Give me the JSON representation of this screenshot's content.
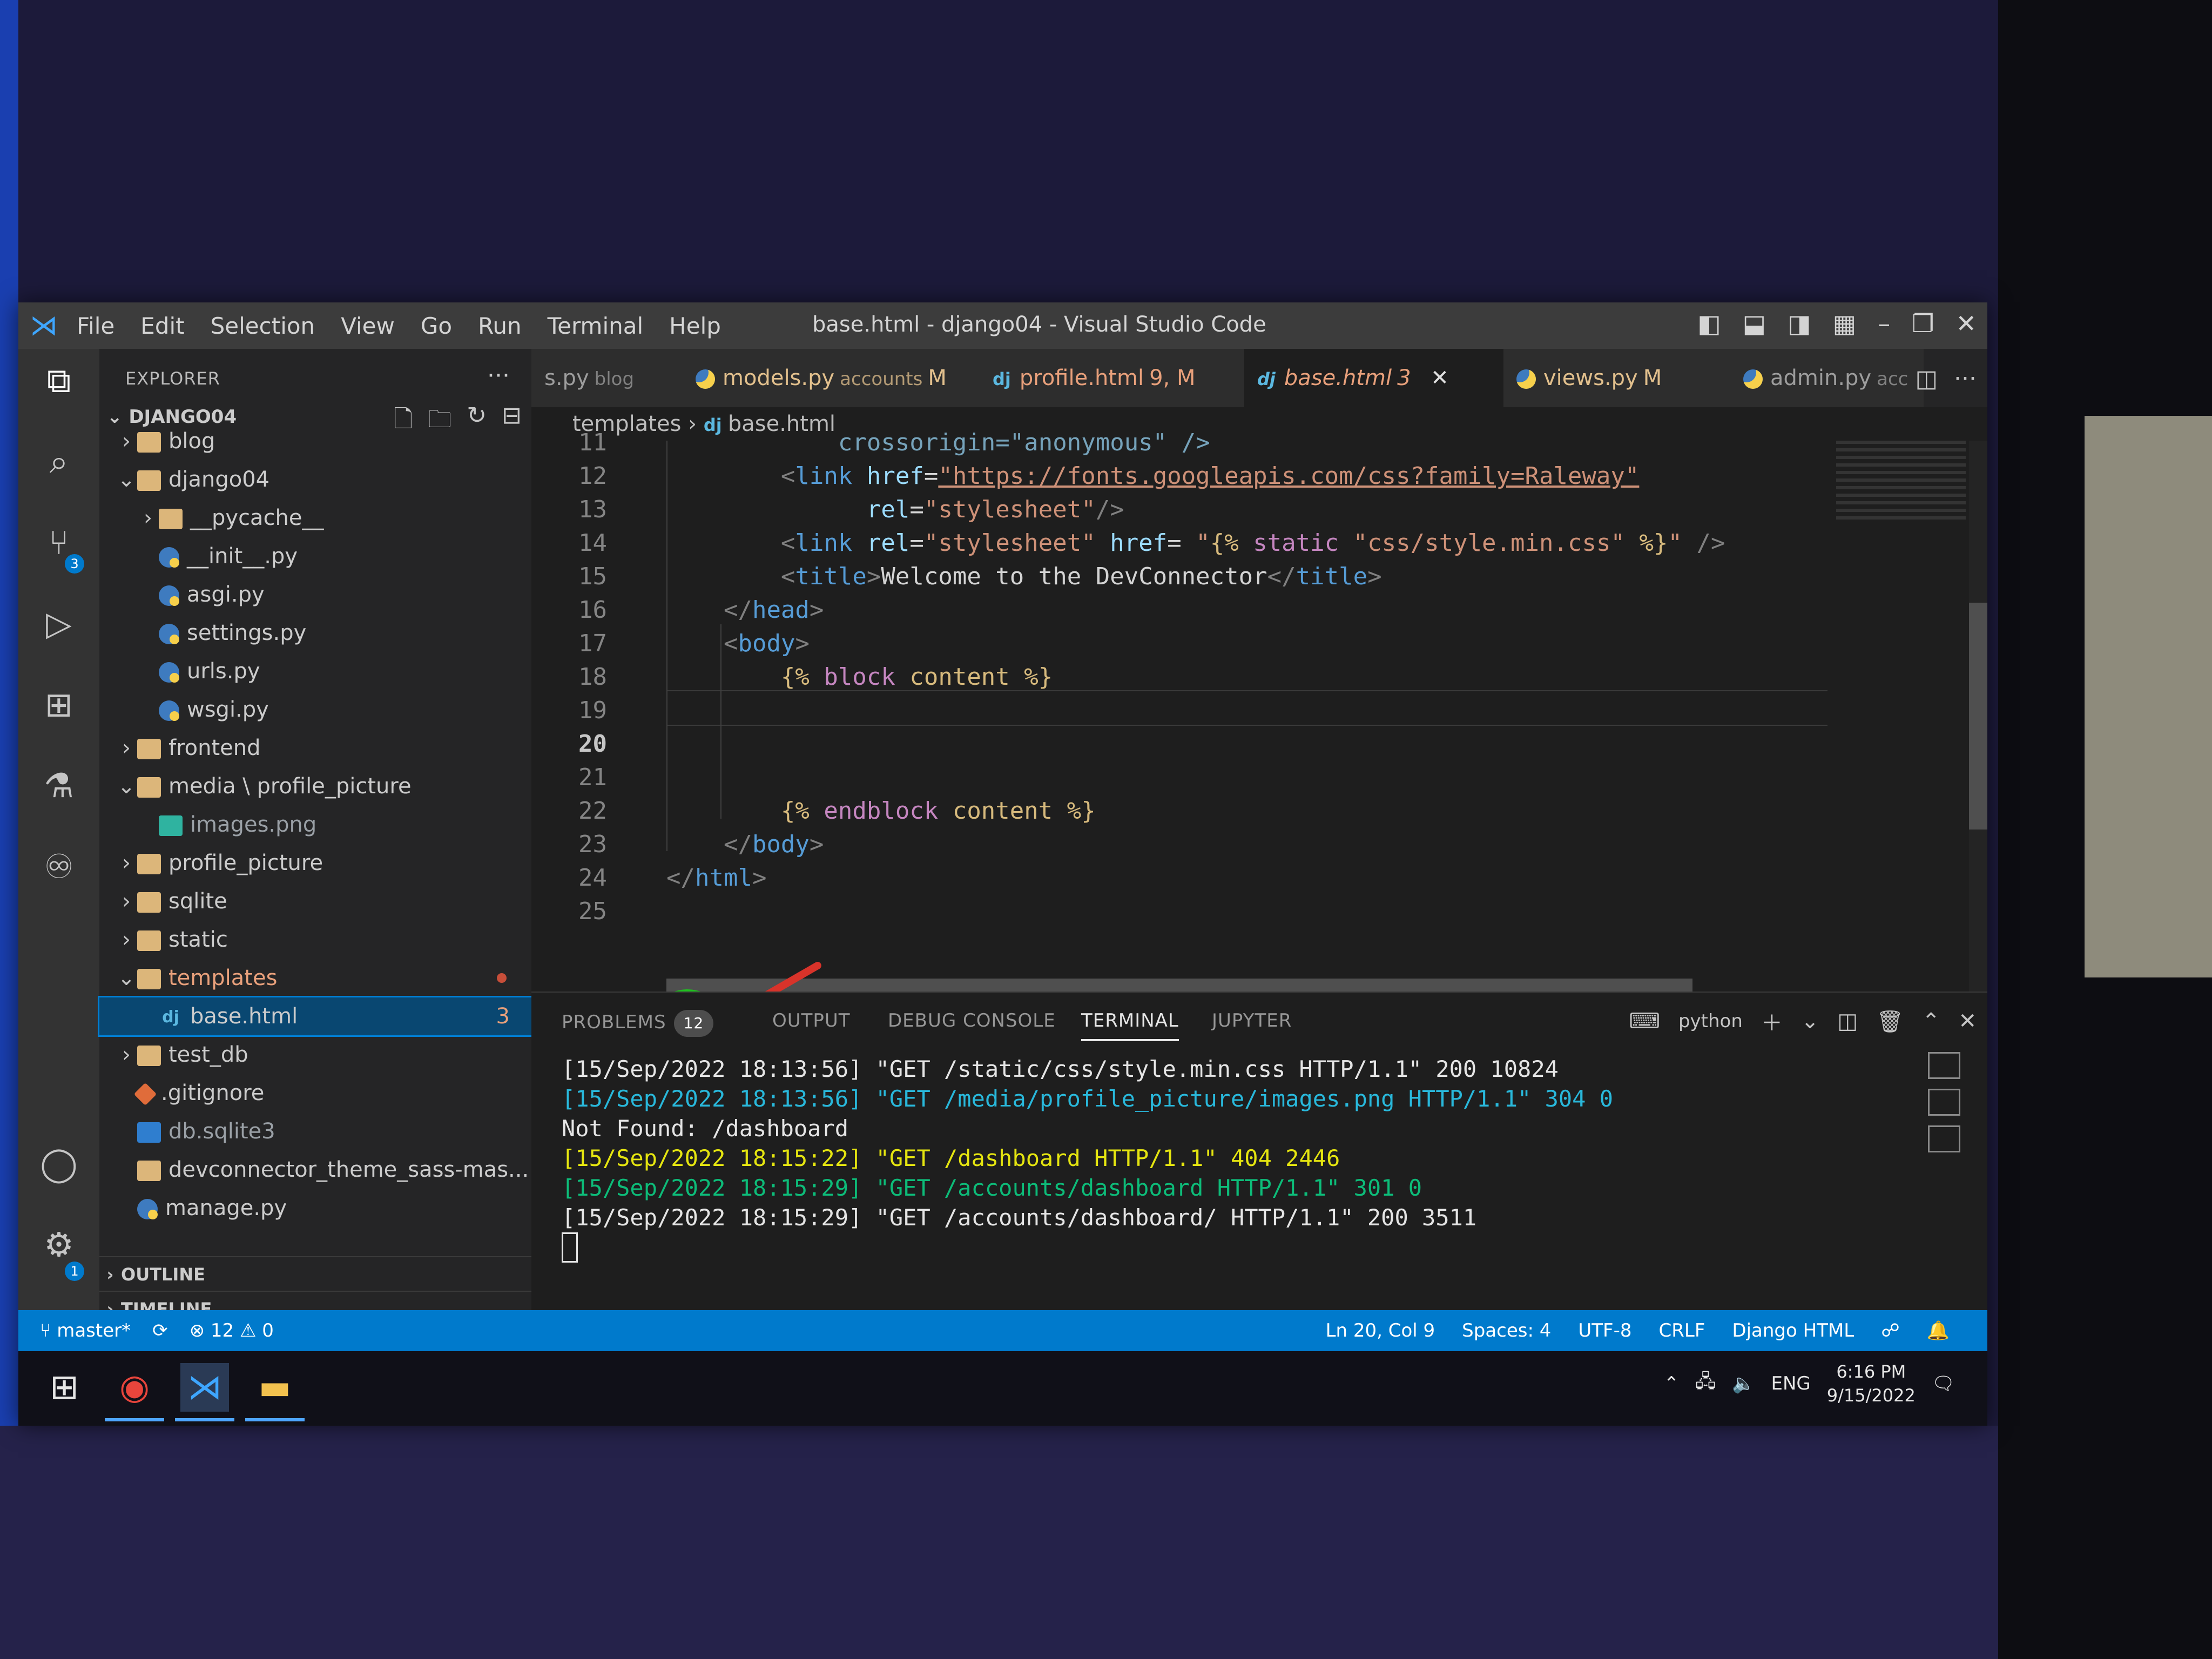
{
  "menu": {
    "items": [
      "File",
      "Edit",
      "Selection",
      "View",
      "Go",
      "Run",
      "Terminal",
      "Help"
    ],
    "window_title": "base.html - django04 - Visual Studio Code"
  },
  "activity": {
    "scm_badge": "3",
    "accounts_badge": "1"
  },
  "sidebar": {
    "header": "EXPLORER",
    "root": "DJANGO04",
    "items": [
      {
        "label": "blog",
        "type": "folder",
        "twisty": "›"
      },
      {
        "label": "django04",
        "type": "folder",
        "twisty": "⌄"
      },
      {
        "label": "__pycache__",
        "type": "folder",
        "twisty": "›"
      },
      {
        "label": "__init__.py",
        "type": "py"
      },
      {
        "label": "asgi.py",
        "type": "py"
      },
      {
        "label": "settings.py",
        "type": "py"
      },
      {
        "label": "urls.py",
        "type": "py"
      },
      {
        "label": "wsgi.py",
        "type": "py"
      },
      {
        "label": "frontend",
        "type": "folder",
        "twisty": "›"
      },
      {
        "label": "media \\ profile_picture",
        "type": "folder",
        "twisty": "⌄"
      },
      {
        "label": "images.png",
        "type": "img"
      },
      {
        "label": "profile_picture",
        "type": "folder",
        "twisty": "›"
      },
      {
        "label": "sqlite",
        "type": "folder",
        "twisty": "›"
      },
      {
        "label": "static",
        "type": "folder",
        "twisty": "›"
      },
      {
        "label": "templates",
        "type": "folder",
        "twisty": "⌄"
      },
      {
        "label": "base.html",
        "type": "dj",
        "badge": "3"
      },
      {
        "label": "test_db",
        "type": "folder",
        "twisty": "›"
      },
      {
        "label": ".gitignore",
        "type": "git"
      },
      {
        "label": "db.sqlite3",
        "type": "db"
      },
      {
        "label": "devconnector_theme_sass-mas...",
        "type": "zip"
      },
      {
        "label": "manage.py",
        "type": "py"
      }
    ],
    "outline": "OUTLINE",
    "timeline": "TIMELINE"
  },
  "tabs": [
    {
      "label": "s.py",
      "desc": "blog"
    },
    {
      "label": "models.py",
      "desc": "accounts",
      "status": "M"
    },
    {
      "label": "profile.html",
      "status": "9, M"
    },
    {
      "label": "base.html",
      "status": "3",
      "active": true
    },
    {
      "label": "views.py",
      "status": "M"
    },
    {
      "label": "admin.py",
      "desc": "acc"
    }
  ],
  "breadcrumb": {
    "folder": "templates",
    "file": "base.html"
  },
  "editor": {
    "lines": [
      {
        "n": "11",
        "text": "crossorigin=\"anonymous\" />"
      },
      {
        "n": "12",
        "text": "<link href=\"https://fonts.googleapis.com/css?family=Raleway\""
      },
      {
        "n": "13",
        "text": "rel=\"stylesheet\"/>"
      },
      {
        "n": "14",
        "text": "<link rel=\"stylesheet\" href= \"{% static \"css/style.min.css\" %}\" />"
      },
      {
        "n": "15",
        "text": "<title>Welcome to the DevConnector</title>"
      },
      {
        "n": "16",
        "text": "</head>"
      },
      {
        "n": "17",
        "text": "<body>"
      },
      {
        "n": "18",
        "text": "{% block content %}"
      },
      {
        "n": "19",
        "text": ""
      },
      {
        "n": "20",
        "text": ""
      },
      {
        "n": "21",
        "text": ""
      },
      {
        "n": "22",
        "text": "{% endblock content %}"
      },
      {
        "n": "23",
        "text": "</body>"
      },
      {
        "n": "24",
        "text": "</html>"
      },
      {
        "n": "25",
        "text": ""
      }
    ],
    "current_line": "20"
  },
  "panel": {
    "tabs": [
      "PROBLEMS",
      "OUTPUT",
      "DEBUG CONSOLE",
      "TERMINAL",
      "JUPYTER"
    ],
    "problems_count": "12",
    "active_tab": "TERMINAL",
    "shell": "python",
    "terminal_lines": [
      {
        "text": "[15/Sep/2022 18:13:56] \"GET /static/css/style.min.css HTTP/1.1\" 200 10824",
        "color": "white"
      },
      {
        "text": "[15/Sep/2022 18:13:56] \"GET /media/profile_picture/images.png HTTP/1.1\" 304 0",
        "color": "blue"
      },
      {
        "text": "Not Found: /dashboard",
        "color": "white"
      },
      {
        "text": "[15/Sep/2022 18:15:22] \"GET /dashboard HTTP/1.1\" 404 2446",
        "color": "yellow"
      },
      {
        "text": "[15/Sep/2022 18:15:29] \"GET /accounts/dashboard HTTP/1.1\" 301 0",
        "color": "green"
      },
      {
        "text": "[15/Sep/2022 18:15:29] \"GET /accounts/dashboard/ HTTP/1.1\" 200 3511",
        "color": "white"
      }
    ]
  },
  "status": {
    "branch": "master*",
    "errors": "12",
    "warnings": "0",
    "position": "Ln 20, Col 9",
    "spaces": "Spaces: 4",
    "encoding": "UTF-8",
    "eol": "CRLF",
    "language": "Django HTML"
  },
  "taskbar": {
    "lang": "ENG",
    "time": "6:16 PM",
    "date": "9/15/2022"
  },
  "colors": {
    "accent": "#007acc",
    "selection": "#094771",
    "modified": "#e2c08d",
    "error_tab": "#e8a07b"
  }
}
